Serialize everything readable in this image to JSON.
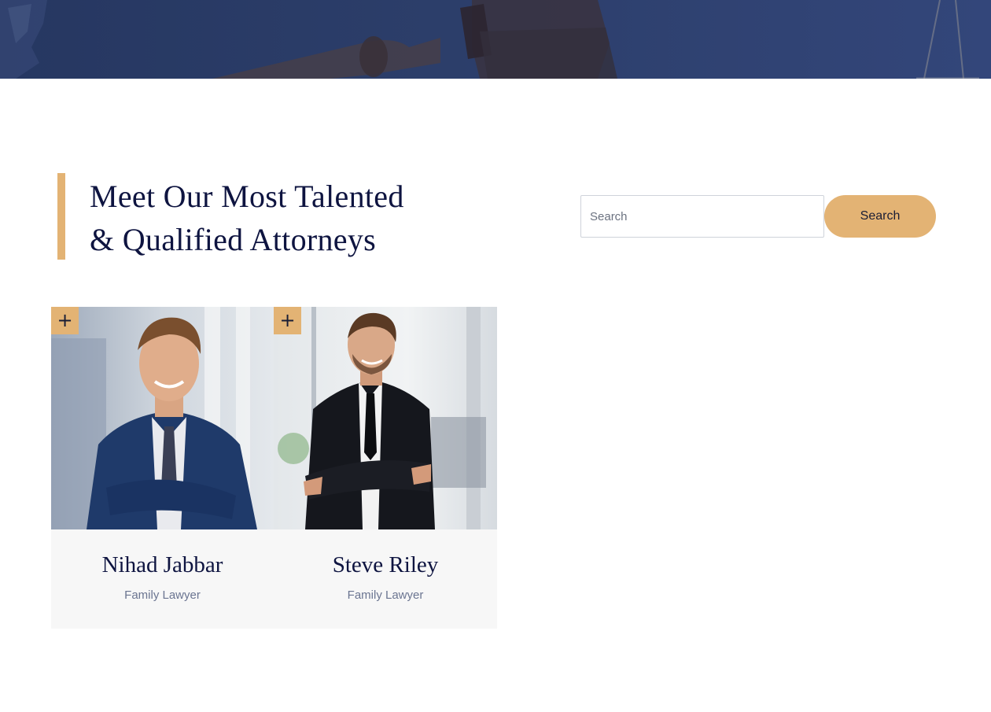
{
  "heading": {
    "line1": "Meet Our Most Talented",
    "line2": "& Qualified Attorneys"
  },
  "search": {
    "placeholder": "Search",
    "value": "",
    "button_label": "Search"
  },
  "attorneys": [
    {
      "name": "Nihad Jabbar",
      "role": "Family Lawyer",
      "expand_label": "+"
    },
    {
      "name": "Steve Riley",
      "role": "Family Lawyer",
      "expand_label": "+"
    }
  ],
  "colors": {
    "accent": "#e3b374",
    "navy": "#0e1440",
    "hero": "#2c3e6a",
    "muted": "#6b7591"
  }
}
